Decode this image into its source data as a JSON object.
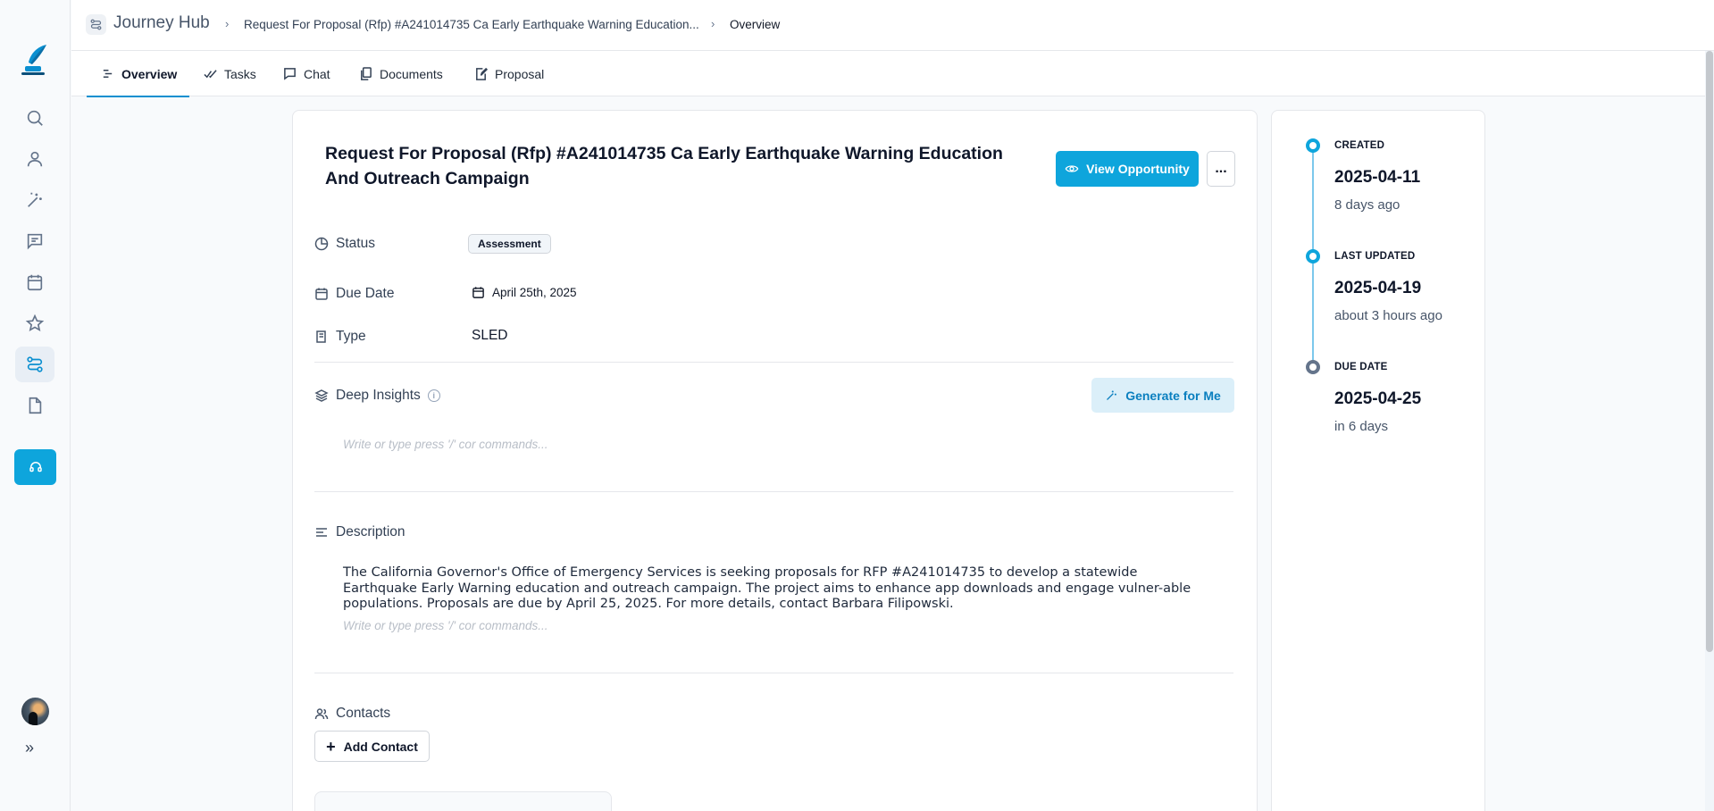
{
  "app": {
    "hub_title": "Journey Hub"
  },
  "breadcrumb": {
    "items": [
      "Request For Proposal (Rfp) #A241014735 Ca Early Earthquake Warning Education...",
      "Overview"
    ]
  },
  "tabs": [
    {
      "label": "Overview",
      "active": true
    },
    {
      "label": "Tasks"
    },
    {
      "label": "Chat"
    },
    {
      "label": "Documents"
    },
    {
      "label": "Proposal"
    }
  ],
  "sidebar": {
    "items": [
      "search-icon",
      "user-icon",
      "magic-wand-icon",
      "message-icon",
      "calendar-icon",
      "star-icon",
      "journey-icon",
      "file-icon"
    ],
    "active": "journey-icon",
    "accent": "#0ea5dc"
  },
  "main": {
    "title": "Request For Proposal (Rfp) #A241014735 Ca Early Earthquake Warning Education And Outreach Campaign",
    "view_button": "View Opportunity",
    "more_button": "...",
    "fields": {
      "status_label": "Status",
      "status_value": "Assessment",
      "due_label": "Due Date",
      "due_value": "April 25th, 2025",
      "type_label": "Type",
      "type_value": "SLED"
    },
    "insights": {
      "label": "Deep Insights",
      "generate_button": "Generate for Me",
      "placeholder": "Write or type press '/' cor commands..."
    },
    "description": {
      "label": "Description",
      "text": "The California Governor's Office of Emergency Services is seeking proposals for RFP #A241014735 to develop a statewide Earthquake Early Warning education and outreach campaign. The project aims to enhance app downloads and engage vulner-able populations. Proposals are due by April 25, 2025. For more details, contact Barbara Filipowski.",
      "placeholder": "Write or type press '/' cor commands..."
    },
    "contacts": {
      "label": "Contacts",
      "add_button": "Add Contact"
    }
  },
  "timeline": [
    {
      "label": "CREATED",
      "date": "2025-04-11",
      "relative": "8 days ago"
    },
    {
      "label": "LAST UPDATED",
      "date": "2025-04-19",
      "relative": "about 3 hours ago"
    },
    {
      "label": "DUE DATE",
      "date": "2025-04-25",
      "relative": "in 6 days"
    }
  ]
}
